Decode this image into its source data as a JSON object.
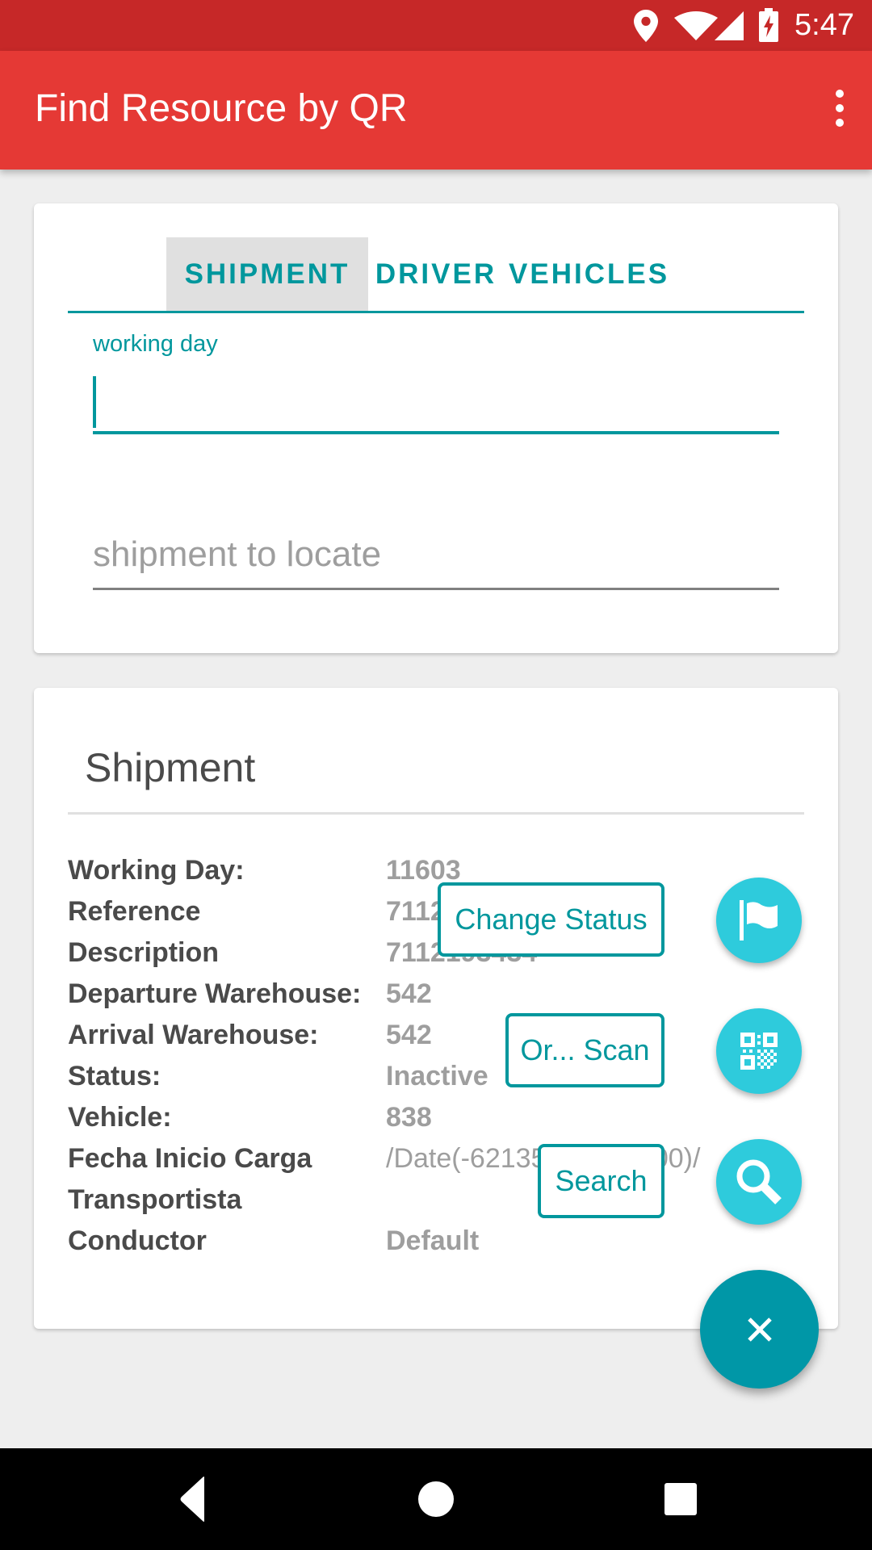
{
  "status_bar": {
    "time": "5:47",
    "icons": [
      "location-icon",
      "wifi-icon",
      "signal-icon",
      "battery-charging-icon"
    ]
  },
  "app_bar": {
    "title": "Find Resource by QR",
    "menu_icon": "more-vert-icon"
  },
  "colors": {
    "status_bar": "#c62828",
    "app_bar": "#e53935",
    "accent": "#00979d",
    "fab": "#2ecbdc",
    "fab_main": "#0097a7"
  },
  "search_card": {
    "tabs": [
      {
        "label": "SHIPMENT",
        "selected": true
      },
      {
        "label": "DRIVER",
        "selected": false
      },
      {
        "label": "VEHICLES",
        "selected": false
      }
    ],
    "working_day": {
      "label": "working day",
      "value": ""
    },
    "shipment_input": {
      "placeholder": "shipment to locate",
      "value": ""
    }
  },
  "shipment_card": {
    "title": "Shipment",
    "rows": [
      {
        "label": "Working Day:",
        "value": "11603"
      },
      {
        "label": "Reference",
        "value": "7112193434"
      },
      {
        "label": "Description",
        "value": "7112193434"
      },
      {
        "label": "Departure Warehouse:",
        "value": "542"
      },
      {
        "label": "Arrival Warehouse:",
        "value": "542"
      },
      {
        "label": "Status:",
        "value": "Inactive"
      },
      {
        "label": "Vehicle:",
        "value": "838"
      },
      {
        "label": "Fecha Inicio Carga",
        "value": "/Date(-62135596800000)/"
      },
      {
        "label": "Transportista",
        "value": ""
      },
      {
        "label": "Conductor",
        "value": "Default"
      }
    ]
  },
  "fab_menu": {
    "actions": [
      {
        "label": "Change Status",
        "icon": "flag-icon"
      },
      {
        "label": "Or... Scan",
        "icon": "qr-code-icon"
      },
      {
        "label": "Search",
        "icon": "search-icon"
      }
    ],
    "main_icon": "close-icon"
  },
  "nav_bar": {
    "buttons": [
      "back-icon",
      "home-icon",
      "recents-icon"
    ]
  }
}
